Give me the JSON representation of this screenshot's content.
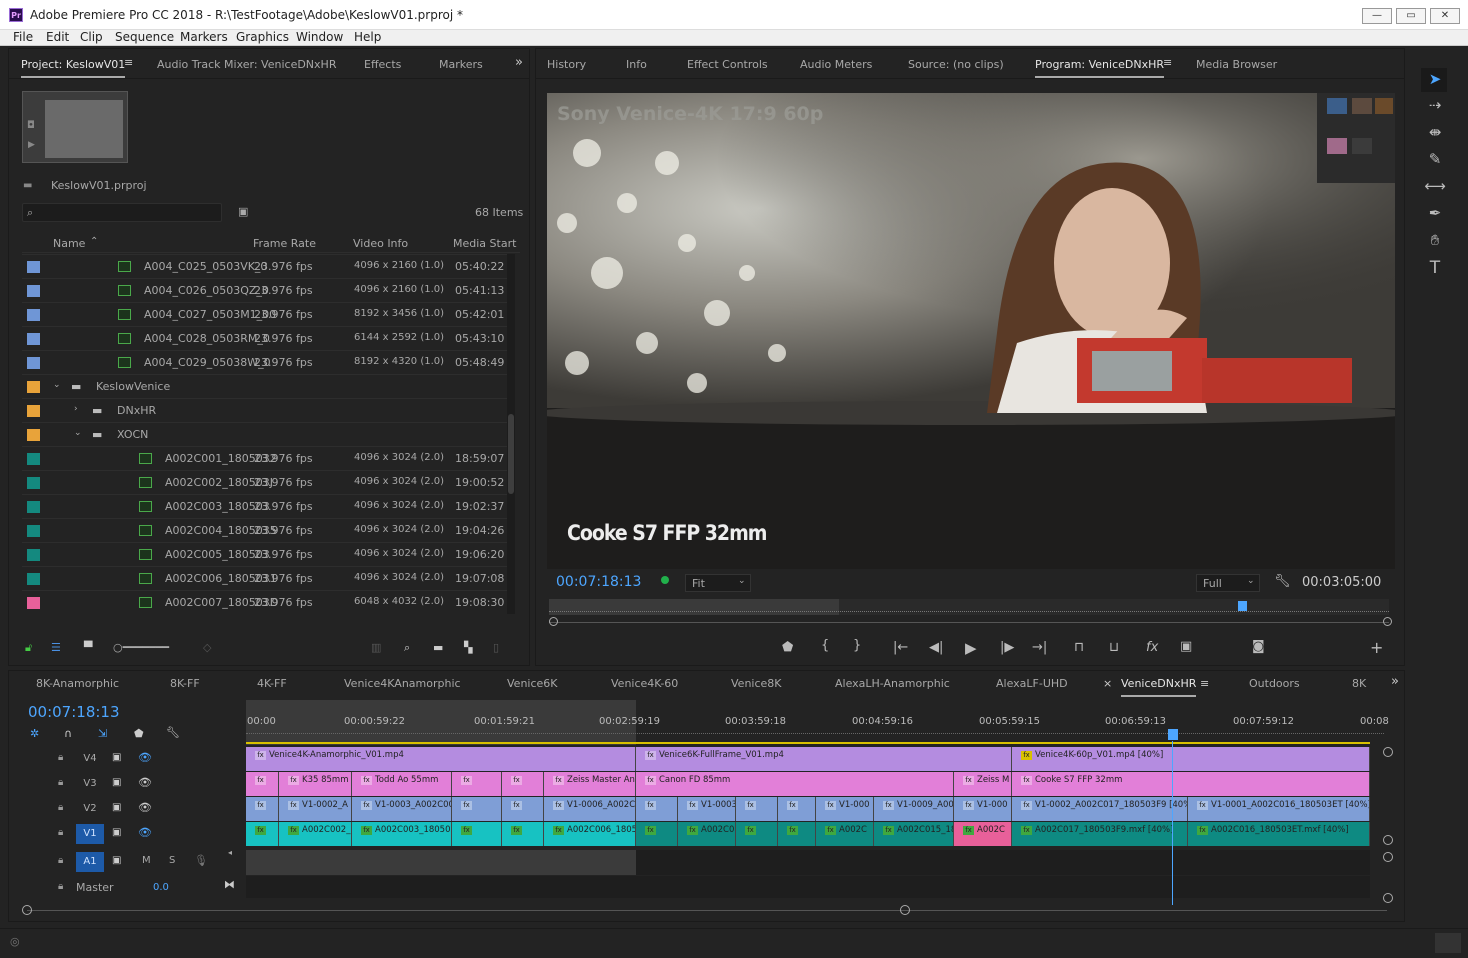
{
  "window": {
    "title": "Adobe Premiere Pro CC 2018 - R:\\TestFootage\\Adobe\\KeslowV01.prproj *",
    "logo": "Pr"
  },
  "menu": [
    "File",
    "Edit",
    "Clip",
    "Sequence",
    "Markers",
    "Graphics",
    "Window",
    "Help"
  ],
  "project_tabs": [
    "Project: KeslowV01",
    "Audio Track Mixer: VeniceDNxHR",
    "Effects",
    "Markers"
  ],
  "project": {
    "file": "KeslowV01.prproj",
    "items_count": "68 Items",
    "search_placeholder": "",
    "columns": [
      "Name",
      "Frame Rate",
      "Video Info",
      "Media Start"
    ],
    "rows": [
      {
        "name": "A004_C025_0503VK_0",
        "fps": "23.976 fps",
        "info": "4096 x 2160 (1.0)",
        "start": "05:40:22",
        "color": "#6f96d6",
        "type": "clip",
        "indent": 1
      },
      {
        "name": "A004_C026_0503QZ_0",
        "fps": "23.976 fps",
        "info": "4096 x 2160 (1.0)",
        "start": "05:41:13",
        "color": "#6f96d6",
        "type": "clip",
        "indent": 1
      },
      {
        "name": "A004_C027_0503M1_00",
        "fps": "23.976 fps",
        "info": "8192 x 3456 (1.0)",
        "start": "05:42:01",
        "color": "#6f96d6",
        "type": "clip",
        "indent": 1
      },
      {
        "name": "A004_C028_0503RM_0",
        "fps": "23.976 fps",
        "info": "6144 x 2592 (1.0)",
        "start": "05:43:10",
        "color": "#6f96d6",
        "type": "clip",
        "indent": 1
      },
      {
        "name": "A004_C029_05038W_0",
        "fps": "23.976 fps",
        "info": "8192 x 4320 (1.0)",
        "start": "05:48:49",
        "color": "#6f96d6",
        "type": "clip",
        "indent": 1
      },
      {
        "name": "KeslowVenice",
        "fps": "",
        "info": "",
        "start": "",
        "color": "#e8a33a",
        "type": "folder-open",
        "indent": 0
      },
      {
        "name": "DNxHR",
        "fps": "",
        "info": "",
        "start": "",
        "color": "#e8a33a",
        "type": "folder-closed",
        "indent": 1
      },
      {
        "name": "XOCN",
        "fps": "",
        "info": "",
        "start": "",
        "color": "#e8a33a",
        "type": "folder-open",
        "indent": 1
      },
      {
        "name": "A002C001_1805032",
        "fps": "23.976 fps",
        "info": "4096 x 3024 (2.0)",
        "start": "18:59:07",
        "color": "#14897f",
        "type": "clip",
        "indent": 2
      },
      {
        "name": "A002C002_180503J",
        "fps": "23.976 fps",
        "info": "4096 x 3024 (2.0)",
        "start": "19:00:52",
        "color": "#14897f",
        "type": "clip",
        "indent": 2
      },
      {
        "name": "A002C003_180503",
        "fps": "23.976 fps",
        "info": "4096 x 3024 (2.0)",
        "start": "19:02:37",
        "color": "#14897f",
        "type": "clip",
        "indent": 2
      },
      {
        "name": "A002C004_1805035",
        "fps": "23.976 fps",
        "info": "4096 x 3024 (2.0)",
        "start": "19:04:26",
        "color": "#14897f",
        "type": "clip",
        "indent": 2
      },
      {
        "name": "A002C005_180503",
        "fps": "23.976 fps",
        "info": "4096 x 3024 (2.0)",
        "start": "19:06:20",
        "color": "#14897f",
        "type": "clip",
        "indent": 2
      },
      {
        "name": "A002C006_1805031",
        "fps": "23.976 fps",
        "info": "4096 x 3024 (2.0)",
        "start": "19:07:08",
        "color": "#14897f",
        "type": "clip",
        "indent": 2
      },
      {
        "name": "A002C007_180503D",
        "fps": "23.976 fps",
        "info": "6048 x 4032 (2.0)",
        "start": "19:08:30",
        "color": "#e8609a",
        "type": "clip",
        "indent": 2
      }
    ]
  },
  "program_tabs": [
    "History",
    "Info",
    "Effect Controls",
    "Audio Meters",
    "Source: (no clips)",
    "Program: VeniceDNxHR",
    "Media Browser"
  ],
  "program": {
    "overlay_top": "Sony Venice-4K 17:9 60p",
    "overlay_bottom": "Cooke S7 FFP 32mm",
    "timecode": "00:07:18:13",
    "fit": "Fit",
    "quality": "Full",
    "duration": "00:03:05:00",
    "playhead_fraction": 0.82
  },
  "sequence_tabs": [
    "8K-Anamorphic",
    "8K-FF",
    "4K-FF",
    "Venice4KAnamorphic",
    "Venice6K",
    "Venice4K-60",
    "Venice8K",
    "AlexaLH-Anamorphic",
    "AlexaLF-UHD",
    "VeniceDNxHR",
    "Outdoors",
    "8K"
  ],
  "timeline": {
    "timecode": "00:07:18:13",
    "ruler": [
      "00:00",
      "00:00:59:22",
      "00:01:59:21",
      "00:02:59:19",
      "00:03:59:18",
      "00:04:59:16",
      "00:05:59:15",
      "00:06:59:13",
      "00:07:59:12",
      "00:08"
    ],
    "tracks": [
      {
        "name": "V4"
      },
      {
        "name": "V3"
      },
      {
        "name": "V2"
      },
      {
        "name": "V1"
      },
      {
        "name": "A1",
        "m": "M",
        "s": "S"
      }
    ],
    "master": {
      "label": "Master",
      "value": "0.0"
    },
    "v4_clips": [
      "Venice4K-Anamorphic_V01.mp4",
      "Venice6K-FullFrame_V01.mp4",
      "Venice4K-60p_V01.mp4 [40%]"
    ],
    "v3_clips": [
      "K35 85mm",
      "Todd Ao 55mm",
      "Zeiss Master An",
      "Canon FD 85mm",
      "Zeiss M",
      "Cooke S7 FFP 32mm"
    ],
    "v2_clips": [
      "V1-0002_A",
      "V1-0003_A002C003",
      "V1-0006_A002C",
      "V1-0003",
      "V1-000",
      "V1-0009_A00",
      "V1-000",
      "V1-0002_A002C017_180503F9 [40%]",
      "V1-0001_A002C016_180503ET [40%]"
    ],
    "v1_clips": [
      "A002C002_",
      "A002C003_180503",
      "A002C006_1805",
      "A002C0",
      "A002C",
      "A002C015_18",
      "A002C",
      "A002C017_180503F9.mxf [40%]",
      "A002C016_180503ET.mxf [40%]"
    ],
    "fx": "fx",
    "colors": {
      "v4": "#b48ce0",
      "v3": "#e27fd8",
      "v2": "#7f9ed6",
      "v1_cyan": "#17c2c2",
      "v1_teal": "#0e8a82",
      "v1_pink": "#e8609a"
    }
  }
}
